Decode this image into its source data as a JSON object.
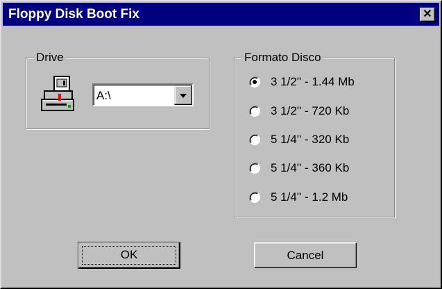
{
  "window": {
    "title": "Floppy Disk Boot Fix",
    "close_glyph": "✕"
  },
  "drive_group": {
    "label": "Drive",
    "icon": "floppy-drive-icon",
    "selected_drive": "A:\\"
  },
  "format_group": {
    "label": "Formato Disco",
    "options": [
      {
        "label": "3 1/2''  - 1.44 Mb",
        "checked": true
      },
      {
        "label": "3 1/2'' - 720 Kb",
        "checked": false
      },
      {
        "label": "5 1/4'' - 320 Kb",
        "checked": false
      },
      {
        "label": "5 1/4'' - 360 Kb",
        "checked": false
      },
      {
        "label": "5 1/4'' - 1.2 Mb",
        "checked": false
      }
    ]
  },
  "buttons": {
    "ok": "OK",
    "cancel": "Cancel"
  },
  "colors": {
    "face": "#c0c0c0",
    "titlebar": "#000080"
  }
}
